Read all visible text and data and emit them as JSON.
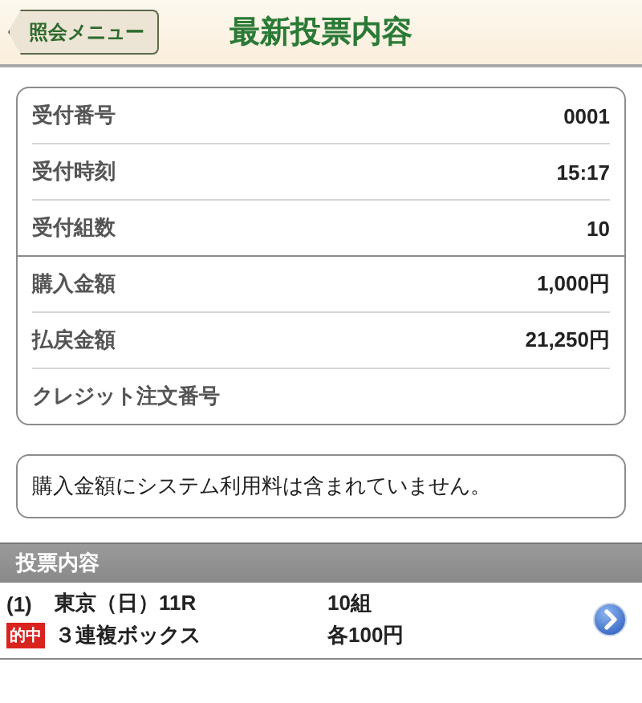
{
  "header": {
    "back_button": "照会メニュー",
    "title": "最新投票内容"
  },
  "summary": {
    "groups": [
      {
        "rows": [
          {
            "label": "受付番号",
            "value": "0001"
          },
          {
            "label": "受付時刻",
            "value": "15:17"
          },
          {
            "label": "受付組数",
            "value": "10"
          }
        ]
      },
      {
        "rows": [
          {
            "label": "購入金額",
            "value": "1,000円"
          },
          {
            "label": "払戻金額",
            "value": "21,250円"
          },
          {
            "label": "クレジット注文番号"
          }
        ]
      }
    ]
  },
  "notice": "購入金額にシステム利用料は含まれていません。",
  "bets": {
    "heading": "投票内容",
    "items": [
      {
        "number": "(1)",
        "race": "東京（日）11R",
        "combos": "10組",
        "hit": true,
        "hit_label": "的中",
        "bet_type": "３連複ボックス",
        "stake": "各100円"
      }
    ]
  }
}
